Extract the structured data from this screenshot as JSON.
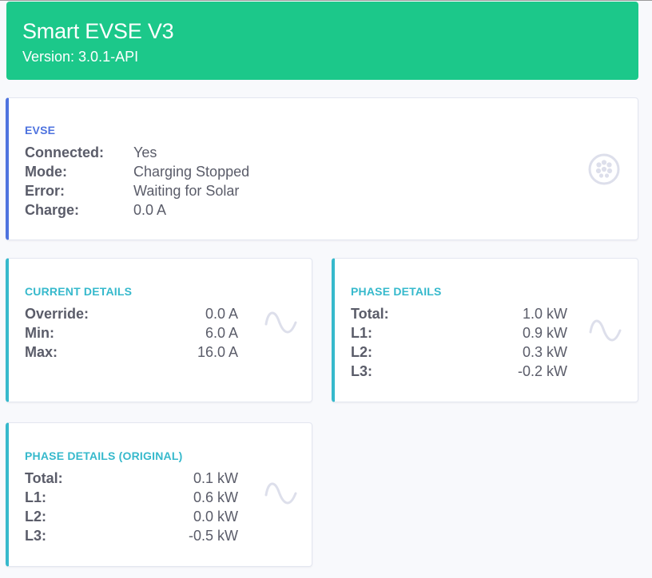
{
  "header": {
    "title": "Smart EVSE V3",
    "version": "Version: 3.0.1-API"
  },
  "evse": {
    "title": "EVSE",
    "icon": "ev-plug-icon",
    "rows": [
      {
        "label": "Connected:",
        "value": "Yes"
      },
      {
        "label": "Mode:",
        "value": "Charging Stopped"
      },
      {
        "label": "Error:",
        "value": "Waiting for Solar"
      },
      {
        "label": "Charge:",
        "value": "0.0 A"
      }
    ]
  },
  "current_details": {
    "title": "CURRENT DETAILS",
    "icon": "sine-wave-icon",
    "rows": [
      {
        "label": "Override:",
        "value": "0.0 A"
      },
      {
        "label": "Min:",
        "value": "6.0 A"
      },
      {
        "label": "Max:",
        "value": "16.0 A"
      }
    ]
  },
  "phase_details": {
    "title": "PHASE DETAILS",
    "icon": "sine-wave-icon",
    "rows": [
      {
        "label": "Total:",
        "value": "1.0 kW"
      },
      {
        "label": "L1:",
        "value": "0.9 kW"
      },
      {
        "label": "L2:",
        "value": "0.3 kW"
      },
      {
        "label": "L3:",
        "value": "-0.2 kW"
      }
    ]
  },
  "phase_details_original": {
    "title": "PHASE DETAILS (ORIGINAL)",
    "icon": "sine-wave-icon",
    "rows": [
      {
        "label": "Total:",
        "value": "0.1 kW"
      },
      {
        "label": "L1:",
        "value": "0.6 kW"
      },
      {
        "label": "L2:",
        "value": "0.0 kW"
      },
      {
        "label": "L3:",
        "value": "-0.5 kW"
      }
    ]
  },
  "colors": {
    "header_bg": "#1cc88a",
    "evse_accent": "#4e73df",
    "details_accent": "#36b9cc",
    "text": "#5a5c69",
    "icon": "#dddfeb"
  }
}
